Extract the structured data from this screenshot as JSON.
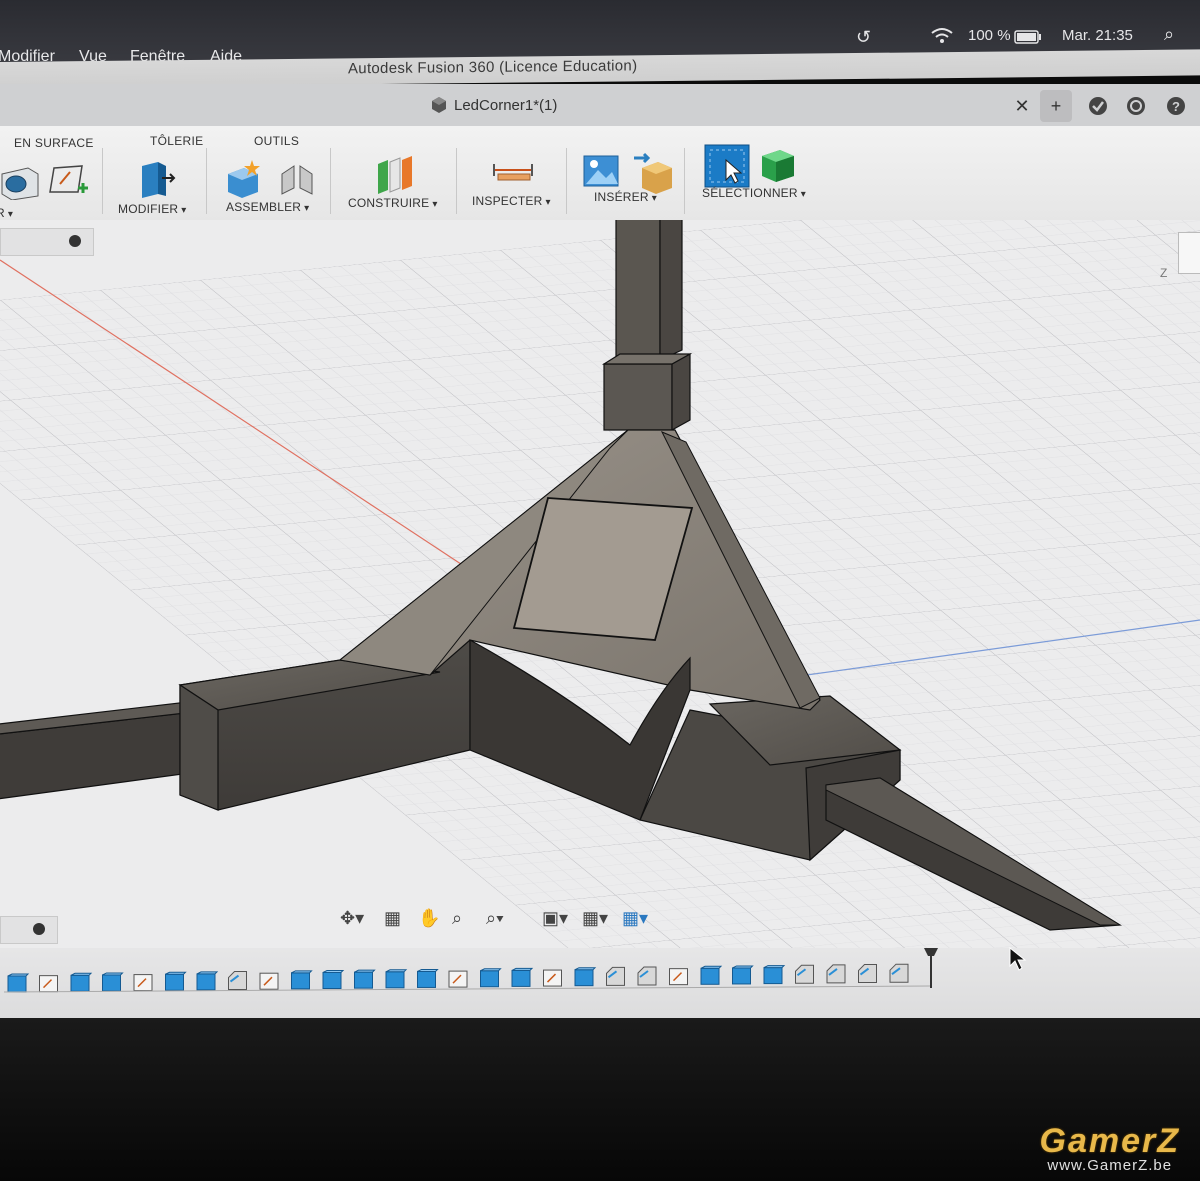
{
  "menubar": {
    "items": [
      "Modifier",
      "Vue",
      "Fenêtre",
      "Aide"
    ],
    "battery": "100 %",
    "clock": "Mar. 21:35"
  },
  "window": {
    "title": "Autodesk Fusion 360 (Licence Education)",
    "document_tab": "LedCorner1*(1)"
  },
  "toolbar": {
    "categories": [
      "EN SURFACE",
      "TÔLERIE",
      "OUTILS"
    ],
    "groups": [
      "MODIFIER",
      "ASSEMBLER",
      "CONSTRUIRE",
      "INSPECTER",
      "INSÉRER",
      "SÉLECTIONNER"
    ],
    "partial_left_group": "R",
    "accent_blue": "#1b7bc6",
    "accent_green": "#3aa24a"
  },
  "viewcube": {
    "axis_label": "Z"
  },
  "timeline": {
    "feature_count": 29
  },
  "watermark": {
    "logo": "GamerZ",
    "url": "www.GamerZ.be"
  }
}
